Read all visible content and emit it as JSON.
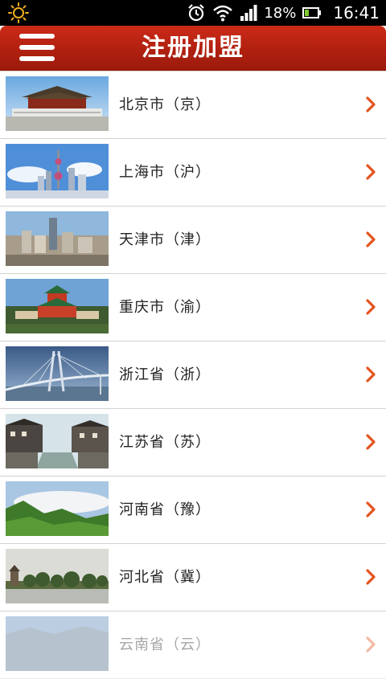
{
  "status_bar": {
    "battery_percent": "18%",
    "time": "16:41",
    "icons": [
      "weather-sun-icon",
      "alarm-icon",
      "wifi-icon",
      "signal-icon",
      "battery-icon"
    ]
  },
  "header": {
    "title": "注册加盟",
    "menu_icon": "menu-icon",
    "accent_color": "#b92214"
  },
  "list": {
    "items": [
      {
        "label": "北京市（京）",
        "thumbnail": "forbidden-city"
      },
      {
        "label": "上海市（沪）",
        "thumbnail": "shanghai-skyline"
      },
      {
        "label": "天津市（津）",
        "thumbnail": "tianjin-city"
      },
      {
        "label": "重庆市（渝）",
        "thumbnail": "chongqing-hall"
      },
      {
        "label": "浙江省（浙）",
        "thumbnail": "bridge"
      },
      {
        "label": "江苏省（苏）",
        "thumbnail": "water-town"
      },
      {
        "label": "河南省（豫）",
        "thumbnail": "mountains"
      },
      {
        "label": "河北省（冀）",
        "thumbnail": "lake-tower"
      },
      {
        "label": "云南省（云）",
        "thumbnail": "hills"
      }
    ],
    "chevron_icon": "chevron-right-icon",
    "chevron_color": "#e3541e"
  }
}
